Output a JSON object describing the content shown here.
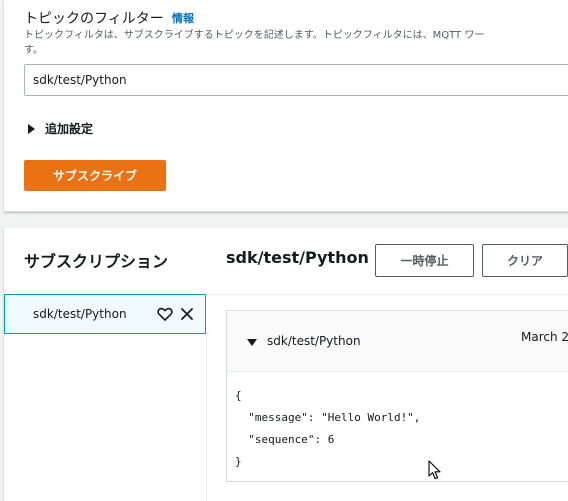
{
  "filter": {
    "label": "トピックのフィルター",
    "info_link": "情報",
    "description_line1": "トピックフィルタは、サブスクライブするトピックを記述します。トピックフィルタには、MQTT ワー",
    "description_line2": "す。",
    "input_value": "sdk/test/Python",
    "additional_settings": "追加設定",
    "subscribe_button": "サブスクライブ"
  },
  "subscriptions": {
    "title": "サブスクリプション",
    "items": [
      {
        "label": "sdk/test/Python"
      }
    ],
    "selected_topic": "sdk/test/Python",
    "pause_button": "一時停止",
    "clear_button": "クリア"
  },
  "message": {
    "topic": "sdk/test/Python",
    "timestamp": "March 2",
    "body": "{\n  \"message\": \"Hello World!\",\n  \"sequence\": 6\n}"
  },
  "icons": {
    "favorite": "heart-outline-icon",
    "remove": "close-icon",
    "expand": "caret-right-icon",
    "collapse": "caret-down-icon"
  },
  "colors": {
    "accent": "#ec7211",
    "link": "#0073bb",
    "selected_border": "#00a1c9",
    "selected_bg": "#f1faff"
  }
}
